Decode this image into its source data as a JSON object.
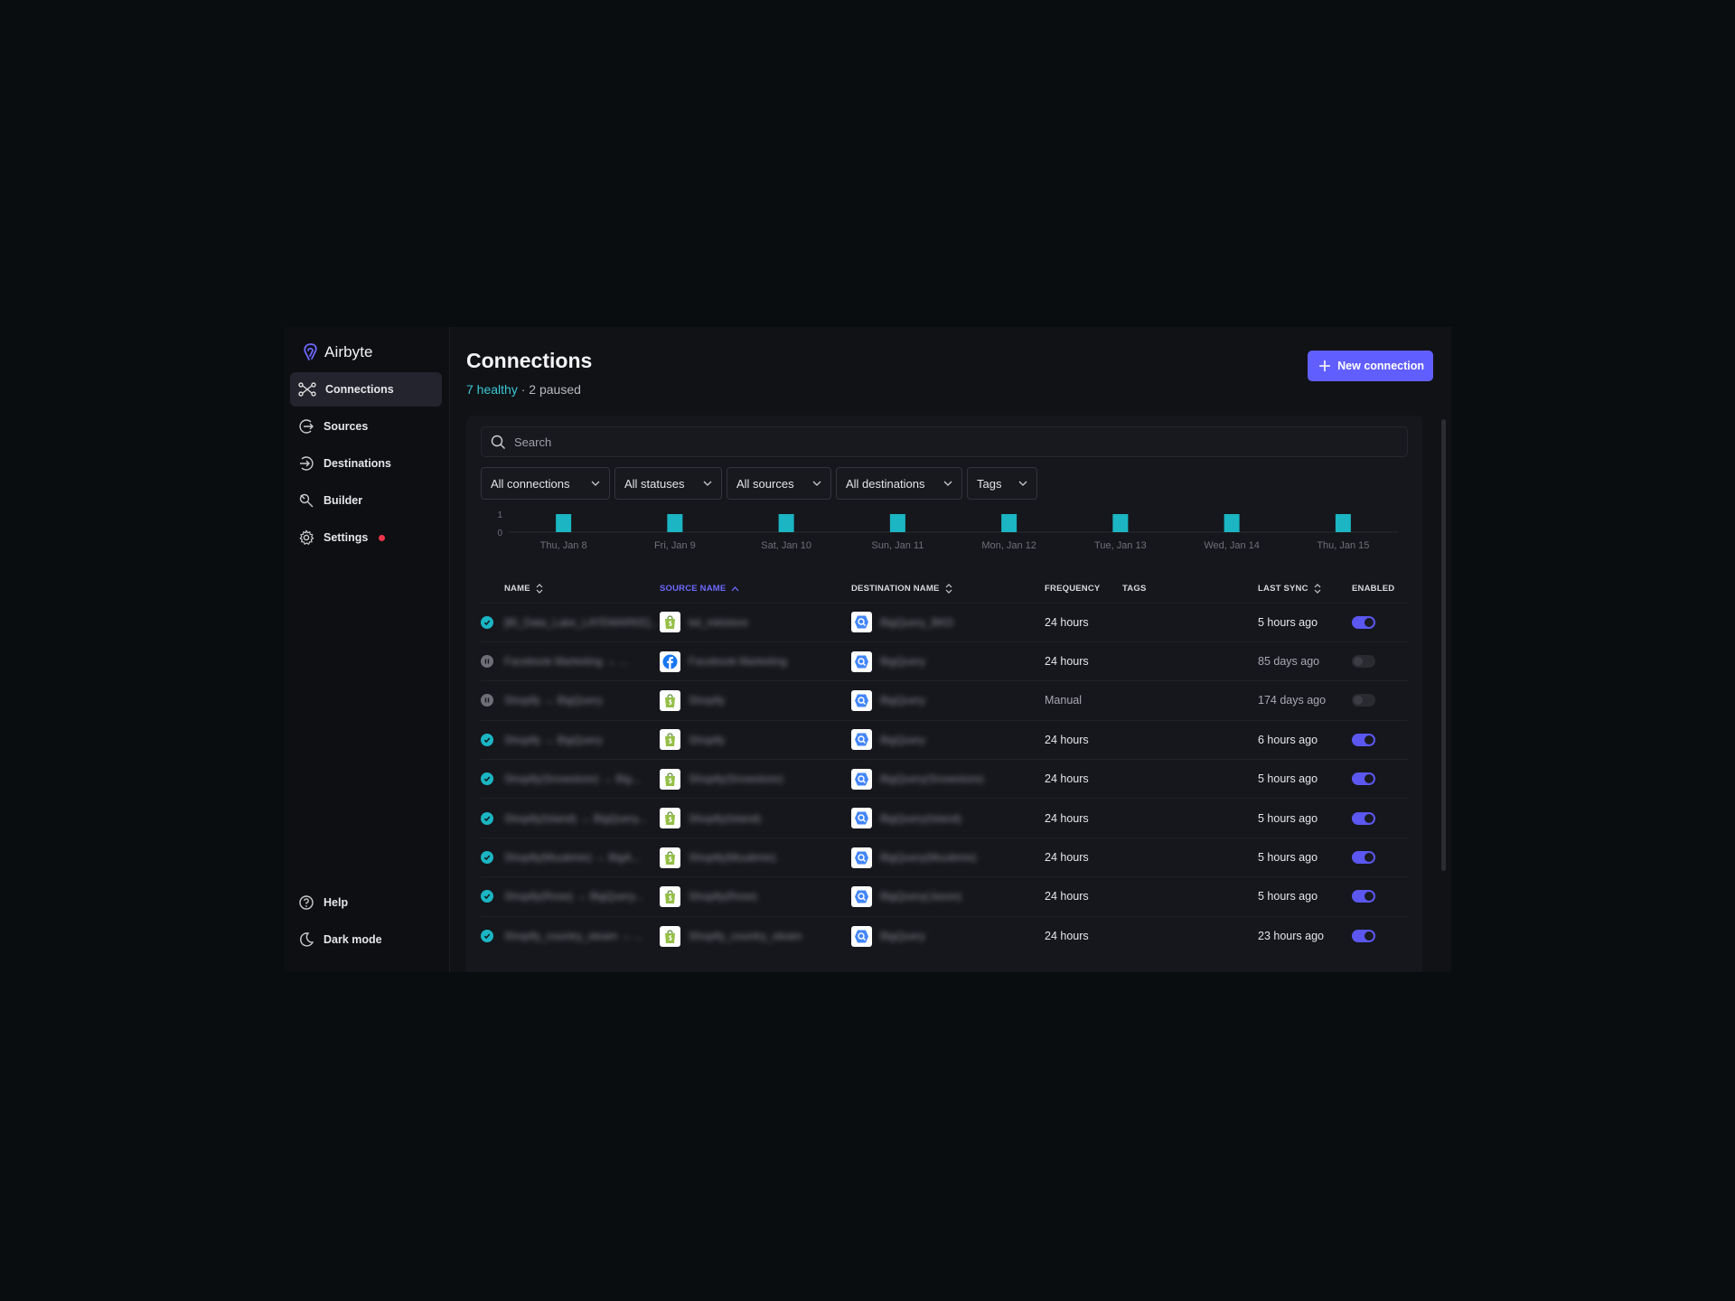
{
  "app": {
    "name": "Airbyte"
  },
  "sidebar": {
    "items": [
      {
        "label": "Connections",
        "icon": "connections-icon"
      },
      {
        "label": "Sources",
        "icon": "sources-icon"
      },
      {
        "label": "Destinations",
        "icon": "destinations-icon"
      },
      {
        "label": "Builder",
        "icon": "builder-icon"
      },
      {
        "label": "Settings",
        "icon": "gear-icon"
      }
    ],
    "bottom": [
      {
        "label": "Help",
        "icon": "help-icon"
      },
      {
        "label": "Dark mode",
        "icon": "moon-icon"
      }
    ]
  },
  "header": {
    "title": "Connections",
    "healthy": "7 healthy",
    "separator": " · ",
    "paused": "2 paused",
    "new_button": "New connection"
  },
  "search": {
    "placeholder": "Search"
  },
  "filters": [
    "All connections",
    "All statuses",
    "All sources",
    "All destinations",
    "Tags"
  ],
  "colors": {
    "accent": "#615eff",
    "healthy": "#3bc8d4",
    "bar": "#1bb5c3"
  },
  "chart_data": {
    "type": "bar",
    "categories": [
      "Thu, Jan 8",
      "Fri, Jan 9",
      "Sat, Jan 10",
      "Sun, Jan 11",
      "Mon, Jan 12",
      "Tue, Jan 13",
      "Wed, Jan 14",
      "Thu, Jan 15"
    ],
    "values": [
      1,
      1,
      1,
      1,
      1,
      1,
      1,
      1
    ],
    "yticks": [
      "1",
      "0"
    ],
    "ylim": [
      0,
      1
    ]
  },
  "table": {
    "headers": {
      "name": "NAME",
      "source": "SOURCE NAME",
      "destination": "DESTINATION NAME",
      "frequency": "FREQUENCY",
      "tags": "TAGS",
      "last_sync": "LAST SYNC",
      "enabled": "ENABLED"
    },
    "rows": [
      {
        "status": "healthy",
        "name": "[BI_Data_Lake_LATEMARKE]...",
        "source_logo": "shopify",
        "source": "bd_mktstore",
        "destination": "BigQuery_BKD",
        "frequency": "24 hours",
        "last_sync": "5 hours ago",
        "enabled": true
      },
      {
        "status": "paused",
        "name": "Facebook Marketing → ...",
        "source_logo": "facebook",
        "source": "Facebook Marketing",
        "destination": "BigQuery",
        "frequency": "24 hours",
        "last_sync": "85 days ago",
        "enabled": false
      },
      {
        "status": "paused",
        "name": "Shopify → BigQuery",
        "source_logo": "shopify",
        "source": "Shopify",
        "destination": "BigQuery",
        "frequency": "Manual",
        "last_sync": "174 days ago",
        "enabled": false
      },
      {
        "status": "healthy",
        "name": "Shopify → BigQuery",
        "source_logo": "shopify",
        "source": "Shopify",
        "destination": "BigQuery",
        "frequency": "24 hours",
        "last_sync": "6 hours ago",
        "enabled": true
      },
      {
        "status": "healthy",
        "name": "Shopify(Snowstore) → Big...",
        "source_logo": "shopify",
        "source": "Shopify(Snowstore)",
        "destination": "BigQuery(Snowstore)",
        "frequency": "24 hours",
        "last_sync": "5 hours ago",
        "enabled": true
      },
      {
        "status": "healthy",
        "name": "Shopify(Island) → BigQuery...",
        "source_logo": "shopify",
        "source": "Shopify(Island)",
        "destination": "BigQuery(Island)",
        "frequency": "24 hours",
        "last_sync": "5 hours ago",
        "enabled": true
      },
      {
        "status": "healthy",
        "name": "Shopify(Muubmix) → BigA...",
        "source_logo": "shopify",
        "source": "Shopify(Muubmix)",
        "destination": "BigQuery(Muubmix)",
        "frequency": "24 hours",
        "last_sync": "5 hours ago",
        "enabled": true
      },
      {
        "status": "healthy",
        "name": "Shopify(Rose) → BigQuery...",
        "source_logo": "shopify",
        "source": "Shopify(Rose)",
        "destination": "BigQuery(Jason)",
        "frequency": "24 hours",
        "last_sync": "5 hours ago",
        "enabled": true
      },
      {
        "status": "healthy",
        "name": "Shopify_country_steam → ...",
        "source_logo": "shopify",
        "source": "Shopify_country_steam",
        "destination": "BigQuery",
        "frequency": "24 hours",
        "last_sync": "23 hours ago",
        "enabled": true
      }
    ]
  }
}
